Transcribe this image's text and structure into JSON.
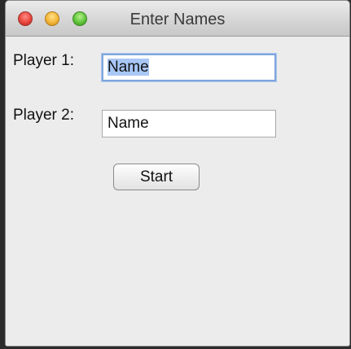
{
  "window": {
    "title": "Enter Names"
  },
  "form": {
    "player1_label": "Player 1:",
    "player1_value": "Name",
    "player2_label": "Player 2:",
    "player2_value": "Name",
    "start_label": "Start"
  }
}
